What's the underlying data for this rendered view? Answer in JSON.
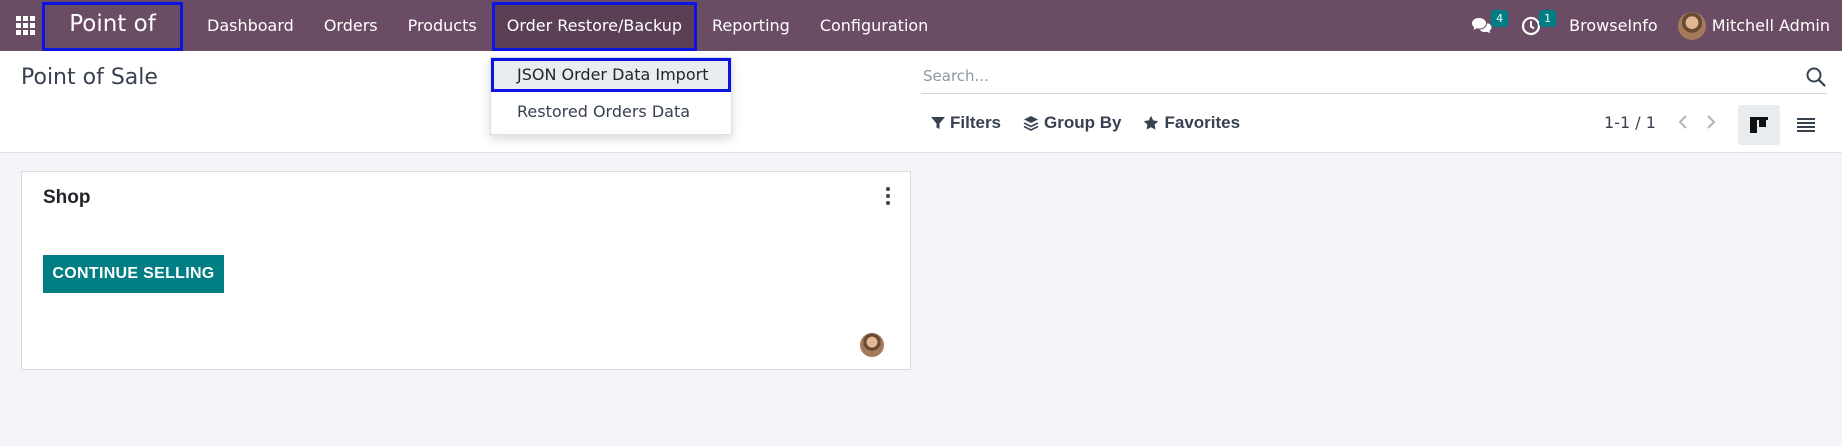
{
  "navbar": {
    "app_name": "Point of Sale",
    "menu": [
      {
        "label": "Dashboard"
      },
      {
        "label": "Orders"
      },
      {
        "label": "Products"
      },
      {
        "label": "Order Restore/Backup"
      },
      {
        "label": "Reporting"
      },
      {
        "label": "Configuration"
      }
    ],
    "messages_count": "4",
    "activities_count": "1",
    "company": "BrowseInfo",
    "user_name": "Mitchell Admin"
  },
  "dropdown": {
    "items": [
      {
        "label": "JSON Order Data Import"
      },
      {
        "label": "Restored Orders Data"
      }
    ]
  },
  "control_panel": {
    "title": "Point of Sale",
    "search_placeholder": "Search...",
    "filters_label": "Filters",
    "group_by_label": "Group By",
    "favorites_label": "Favorites",
    "pager": "1-1 / 1"
  },
  "kanban": {
    "card_title": "Shop",
    "button_label": "CONTINUE SELLING"
  },
  "colors": {
    "navbar": "#6a4c64",
    "accent": "#017e84",
    "highlight": "#0b14e0"
  }
}
